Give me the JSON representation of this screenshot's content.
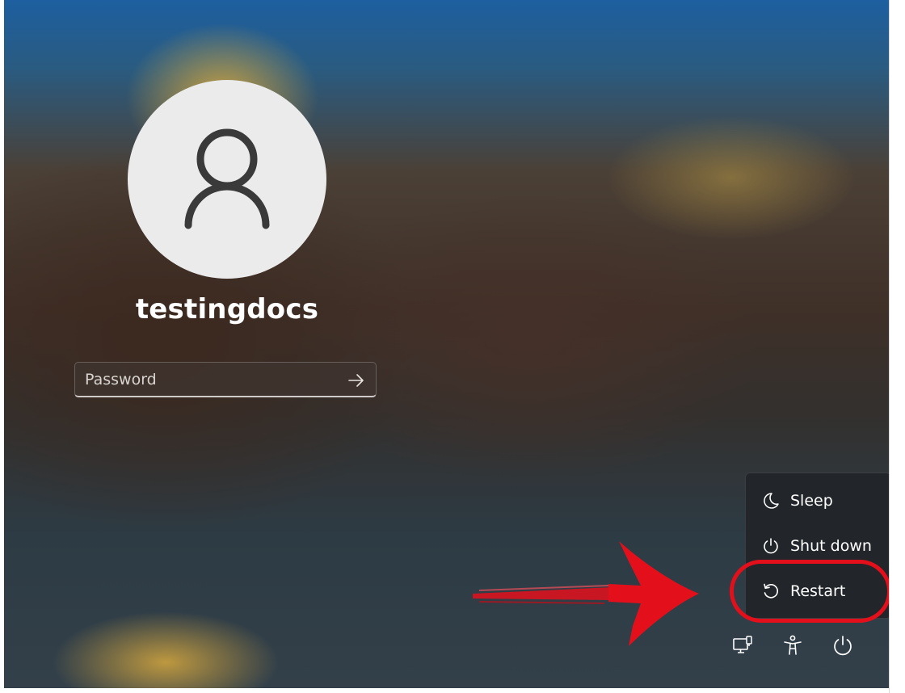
{
  "lock_screen": {
    "username": "testingdocs",
    "password_placeholder": "Password"
  },
  "power_menu": {
    "items": [
      {
        "label": "Sleep",
        "icon": "moon-icon"
      },
      {
        "label": "Shut down",
        "icon": "power-icon"
      },
      {
        "label": "Restart",
        "icon": "restart-icon"
      }
    ]
  },
  "tray": {
    "icons": [
      "network-icon",
      "accessibility-icon",
      "power-icon"
    ]
  },
  "annotation": {
    "highlight_color": "#e3101c",
    "target": "Restart"
  },
  "colors": {
    "avatar_bg": "#ebebeb",
    "menu_bg": "#22262a",
    "text": "#ffffff"
  }
}
